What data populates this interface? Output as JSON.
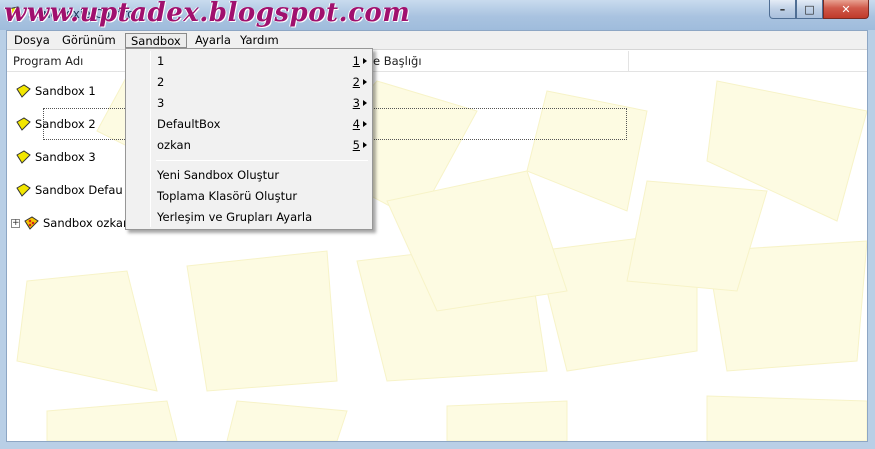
{
  "window": {
    "title": "Sandboxie Control",
    "minimize": "–",
    "maximize": "□",
    "close": "✕"
  },
  "watermark": "www.uptadex.blogspot.com",
  "menubar": {
    "items": [
      {
        "label": "Dosya"
      },
      {
        "label": "Görünüm"
      },
      {
        "label": "Sandbox"
      },
      {
        "label": "Ayarla"
      },
      {
        "label": "Yardım"
      }
    ]
  },
  "columns": {
    "program": "Program Adı",
    "window_title": "e Başlığı"
  },
  "rows": [
    {
      "label": "Sandbox 1",
      "icon": "sandbox-yellow-icon"
    },
    {
      "label": "Sandbox 2",
      "icon": "sandbox-yellow-icon"
    },
    {
      "label": "Sandbox 3",
      "icon": "sandbox-yellow-icon"
    },
    {
      "label": "Sandbox Defau",
      "icon": "sandbox-yellow-icon"
    },
    {
      "label": "Sandbox ozkan",
      "icon": "sandbox-active-icon",
      "expander": "+"
    }
  ],
  "sandbox_menu": {
    "items": [
      {
        "label": "1",
        "shortcut": "1"
      },
      {
        "label": "2",
        "shortcut": "2"
      },
      {
        "label": "3",
        "shortcut": "3"
      },
      {
        "label": "DefaultBox",
        "shortcut": "4"
      },
      {
        "label": "ozkan",
        "shortcut": "5"
      }
    ],
    "actions": [
      {
        "label": "Yeni Sandbox Oluştur"
      },
      {
        "label": "Toplama Klasörü Oluştur"
      },
      {
        "label": "Yerleşim ve Grupları Ayarla"
      }
    ]
  },
  "colors": {
    "background_tile": "#fdfbe2",
    "watermark": "#a0106e",
    "sandbox_icon": "#f2e600"
  }
}
